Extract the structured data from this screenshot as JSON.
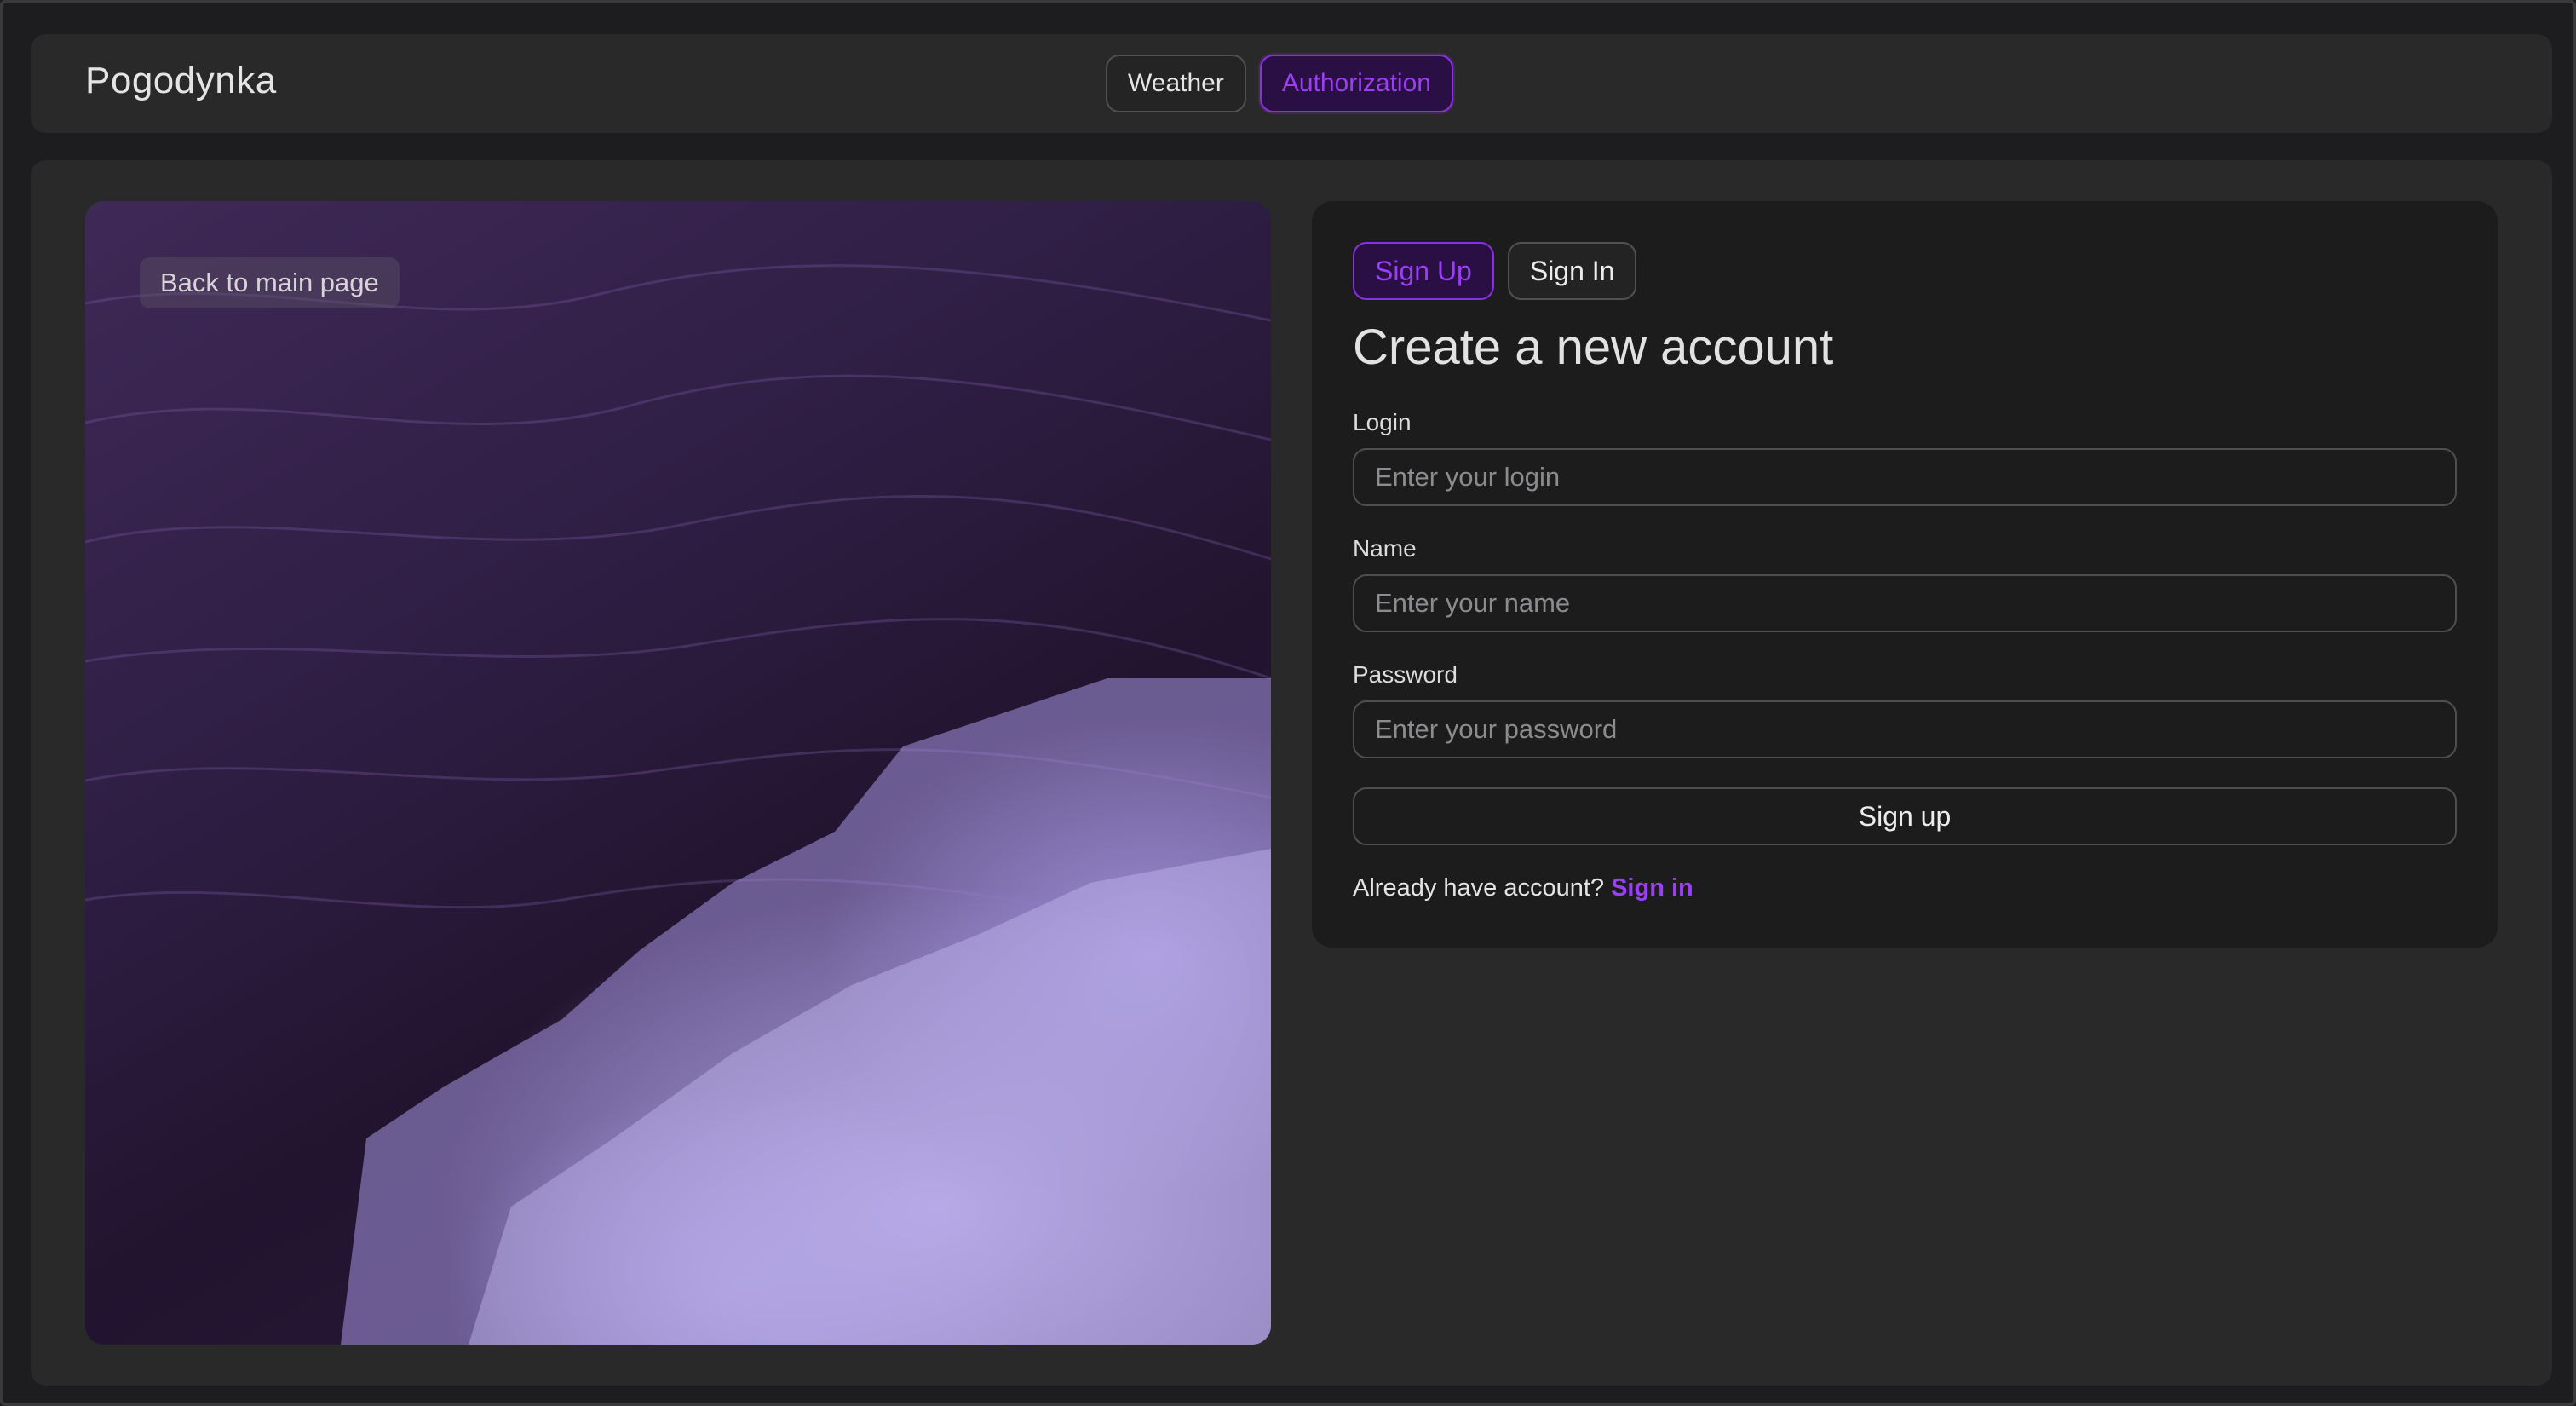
{
  "header": {
    "brand": "Pogodynka",
    "nav": [
      {
        "label": "Weather",
        "active": false
      },
      {
        "label": "Authorization",
        "active": true
      }
    ]
  },
  "hero": {
    "back_label": "Back to main page",
    "image_subject": "ocean waves foam"
  },
  "auth_card": {
    "tabs": [
      {
        "label": "Sign Up",
        "active": true
      },
      {
        "label": "Sign In",
        "active": false
      }
    ],
    "title": "Create a new account",
    "fields": {
      "login": {
        "label": "Login",
        "placeholder": "Enter your login",
        "value": ""
      },
      "name": {
        "label": "Name",
        "placeholder": "Enter your name",
        "value": ""
      },
      "password": {
        "label": "Password",
        "placeholder": "Enter your password",
        "value": ""
      }
    },
    "submit_label": "Sign up",
    "footer": {
      "text": "Already have account?",
      "link": "Sign in"
    }
  },
  "colors": {
    "accent": "#9b3ff2",
    "accent_bg": "#2a0f45",
    "surface": "#29292a",
    "card": "#1c1c1d"
  }
}
